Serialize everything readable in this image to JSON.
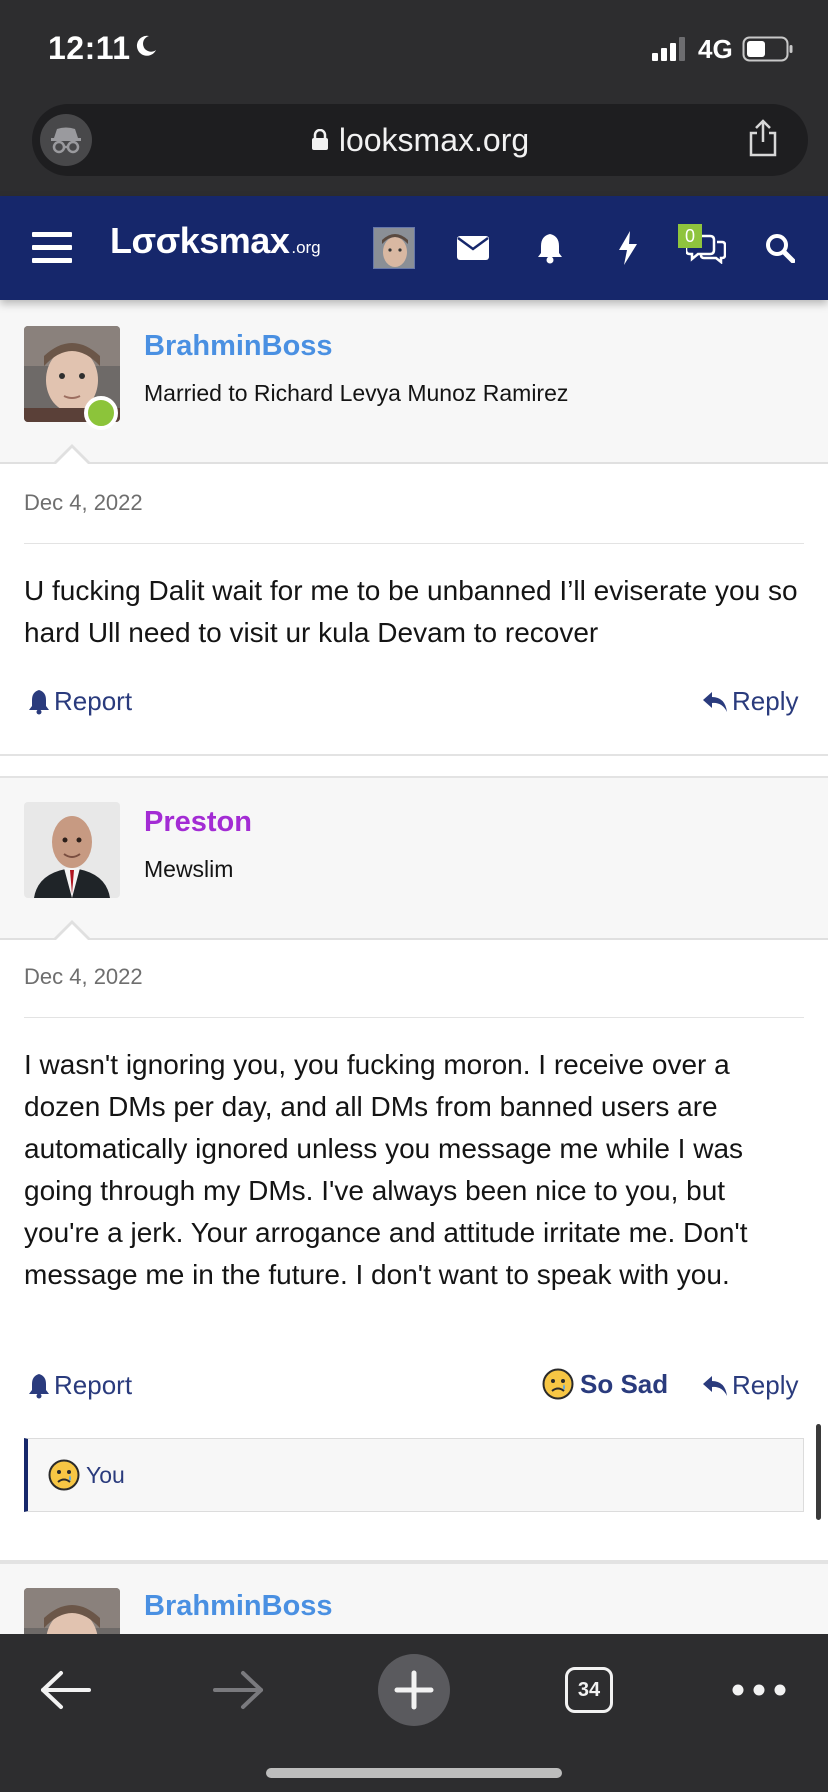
{
  "status_bar": {
    "time": "12:11",
    "network": "4G"
  },
  "browser": {
    "url": "looksmax.org"
  },
  "site_nav": {
    "logo_main": "Lσσksmax",
    "logo_sub": ".org",
    "chat_badge": "0"
  },
  "posts": [
    {
      "user_name": "BrahminBoss",
      "user_title": "Married to Richard Levya Munoz Ramirez",
      "name_color": "#4a90e2",
      "online": true,
      "date": "Dec 4, 2022",
      "body": "U fucking Dalit wait for me to be unbanned I’ll eviserate you so hard Ull need to visit ur kula Devam to recover",
      "report_label": "Report",
      "reply_label": "Reply"
    },
    {
      "user_name": "Preston",
      "user_title": "Mewslim",
      "name_color": "#a32cd4",
      "online": false,
      "date": "Dec 4, 2022",
      "body": "I wasn't ignoring you, you fucking moron. I receive over a dozen DMs per day, and all DMs from banned users are automatically ignored unless you message me while I was going through my DMs. I've always been nice to you, but you're a jerk. Your arrogance and attitude irritate me. Don't message me in the future. I don't want to speak with you.",
      "report_label": "Report",
      "reaction_label": "So Sad",
      "reply_label": "Reply",
      "reactions_by": "You"
    },
    {
      "user_name": "BrahminBoss",
      "name_color": "#4a90e2"
    }
  ],
  "toolbar": {
    "tabs_count": "34"
  },
  "colors": {
    "nav_background": "#16276b",
    "action_text": "#2a3b7d",
    "online_dot": "#8cc43a",
    "chat_badge": "#8fc43d"
  }
}
